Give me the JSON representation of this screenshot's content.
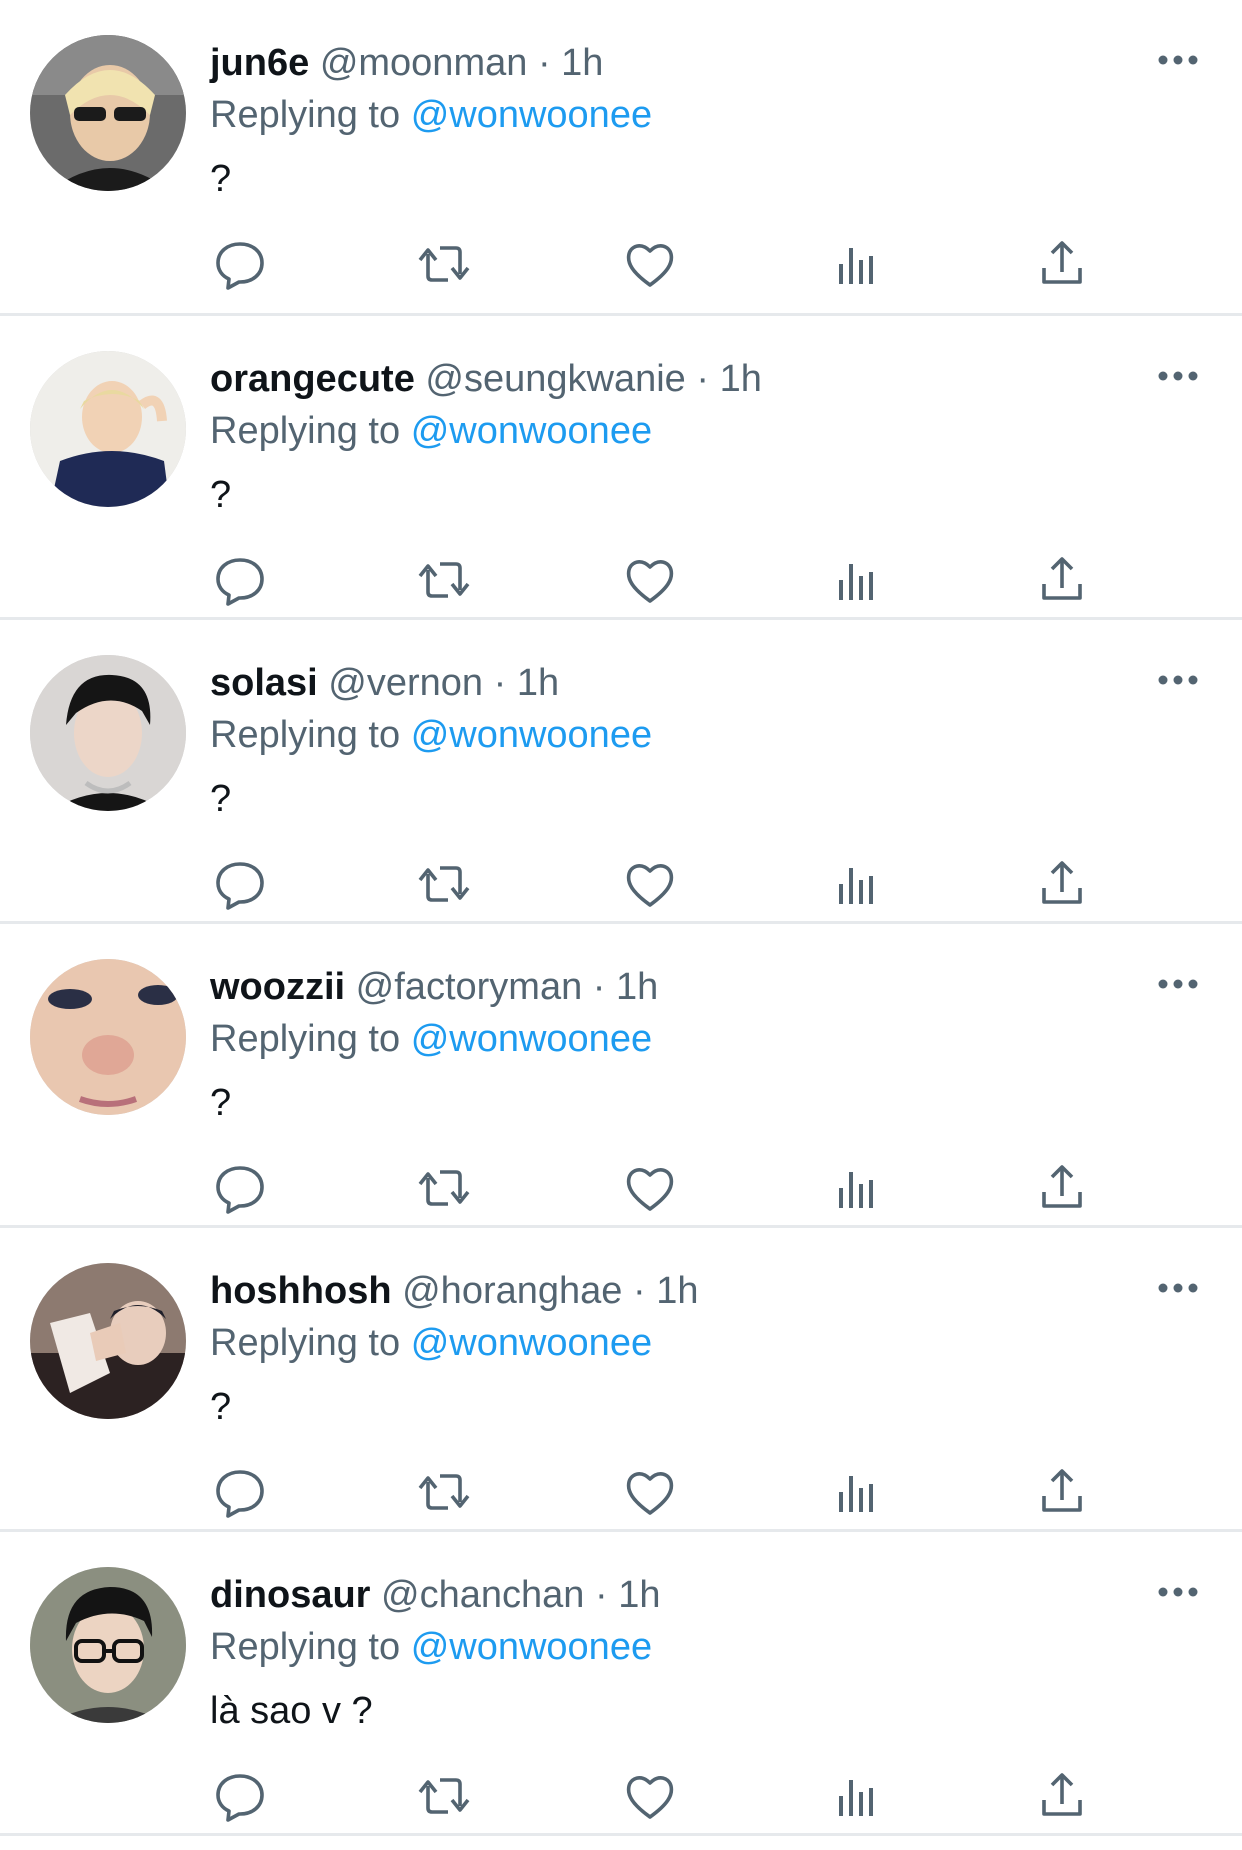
{
  "tweets": [
    {
      "name": "jun6e",
      "handle": "@moonman",
      "dot": "·",
      "time": "1h",
      "replying_label": "Replying to",
      "replying_handle": "@wonwoonee",
      "text": "?",
      "avatar": "avatar-blonde-sunglasses"
    },
    {
      "name": "orangecute",
      "handle": "@seungkwanie",
      "dot": "·",
      "time": "1h",
      "replying_label": "Replying to",
      "replying_handle": "@wonwoonee",
      "text": "?",
      "avatar": "avatar-blonde-hoodie"
    },
    {
      "name": "solasi",
      "handle": "@vernon",
      "dot": "·",
      "time": "1h",
      "replying_label": "Replying to",
      "replying_handle": "@wonwoonee",
      "text": "?",
      "avatar": "avatar-dark-hair"
    },
    {
      "name": "woozzii",
      "handle": "@factoryman",
      "dot": "·",
      "time": "1h",
      "replying_label": "Replying to",
      "replying_handle": "@wonwoonee",
      "text": "?",
      "avatar": "avatar-face-closeup"
    },
    {
      "name": "hoshhosh",
      "handle": "@horanghae",
      "dot": "·",
      "time": "1h",
      "replying_label": "Replying to",
      "replying_handle": "@wonwoonee",
      "text": "?",
      "avatar": "avatar-hand-wave"
    },
    {
      "name": "dinosaur",
      "handle": "@chanchan",
      "dot": "·",
      "time": "1h",
      "replying_label": "Replying to",
      "replying_handle": "@wonwoonee",
      "text": "là sao v ?",
      "avatar": "avatar-glasses"
    }
  ],
  "colors": {
    "link": "#1d9bf0",
    "secondary": "#536471",
    "primary": "#0f1419",
    "divider": "#e6e9ec"
  },
  "icons": [
    "reply-icon",
    "retweet-icon",
    "like-icon",
    "views-icon",
    "share-icon",
    "more-icon"
  ]
}
